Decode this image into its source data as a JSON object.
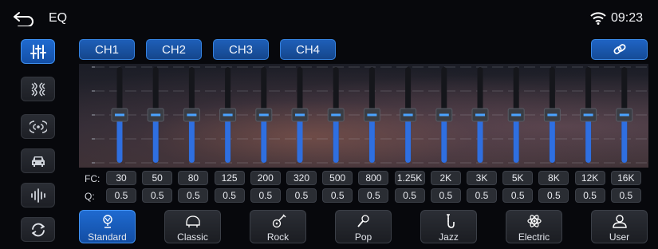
{
  "header": {
    "title": "EQ",
    "time": "09:23"
  },
  "sidebar": [
    {
      "icon": "eq-sliders-icon",
      "active": true
    },
    {
      "icon": "sound-field-icon",
      "active": false
    },
    {
      "icon": "balance-icon",
      "active": false
    },
    {
      "icon": "car-icon",
      "active": false
    },
    {
      "icon": "waveform-icon",
      "active": false
    },
    {
      "icon": "reset-icon",
      "active": false
    }
  ],
  "channels": [
    "CH1",
    "CH2",
    "CH3",
    "CH4"
  ],
  "scale": {
    "ticks": [
      "8",
      "4",
      "0",
      "-4",
      "-8"
    ],
    "min": -8,
    "max": 8
  },
  "bands": {
    "fc_label": "FC:",
    "q_label": "Q:",
    "frequencies": [
      "30",
      "50",
      "80",
      "125",
      "200",
      "320",
      "500",
      "800",
      "1.25K",
      "2K",
      "3K",
      "5K",
      "8K",
      "12K",
      "16K"
    ],
    "q_values": [
      "0.5",
      "0.5",
      "0.5",
      "0.5",
      "0.5",
      "0.5",
      "0.5",
      "0.5",
      "0.5",
      "0.5",
      "0.5",
      "0.5",
      "0.5",
      "0.5",
      "0.5"
    ],
    "gains": [
      0,
      0,
      0,
      0,
      0,
      0,
      0,
      0,
      0,
      0,
      0,
      0,
      0,
      0,
      0
    ]
  },
  "presets": [
    {
      "label": "Standard",
      "icon": "standard-icon",
      "active": true
    },
    {
      "label": "Classic",
      "icon": "piano-icon",
      "active": false
    },
    {
      "label": "Rock",
      "icon": "guitar-icon",
      "active": false
    },
    {
      "label": "Pop",
      "icon": "microphone-icon",
      "active": false
    },
    {
      "label": "Jazz",
      "icon": "saxophone-icon",
      "active": false
    },
    {
      "label": "Electric",
      "icon": "atom-icon",
      "active": false
    },
    {
      "label": "User",
      "icon": "user-icon",
      "active": false
    }
  ],
  "colors": {
    "accent": "#1f6ad0",
    "slider_fill": "#2f6fe0",
    "knob_indicator": "#4aa3ff"
  }
}
